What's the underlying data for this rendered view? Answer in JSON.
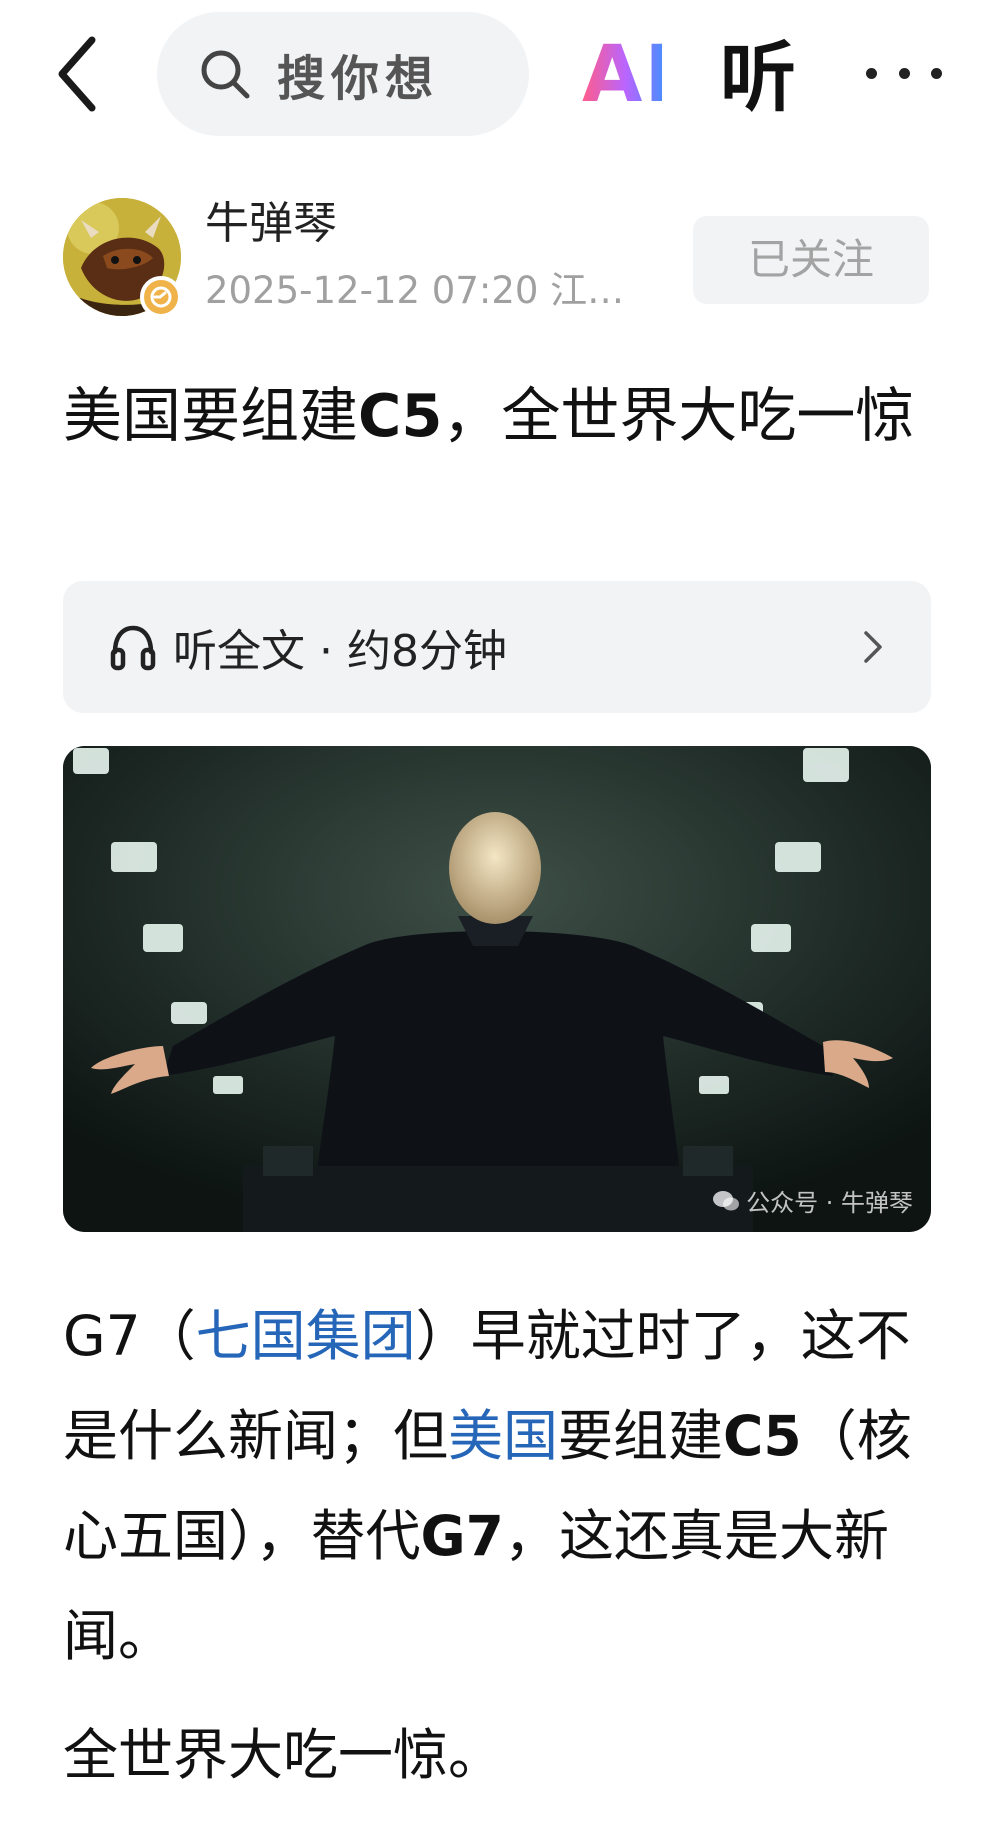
{
  "header": {
    "back_icon": "back-arrow-icon",
    "search_icon": "search-icon",
    "search_placeholder": "搜你想",
    "search_overflow": "搜",
    "ai_label": "AI",
    "listen_label": "听",
    "more_icon": "more-dots-icon"
  },
  "author": {
    "name": "牛弹琴",
    "meta": "2025-12-12  07:20  江…",
    "follow_label": "已关注",
    "badge_icon": "verified-badge-icon"
  },
  "article": {
    "title_a": "美国要组建",
    "title_b": "C5",
    "title_c": "，全世界大吃一惊",
    "listen_bar": {
      "icon": "headphone-icon",
      "label": "听全文 · 约8分钟",
      "chevron": "chevron-right-icon"
    },
    "image": {
      "watermark": "公众号 · 牛弹琴"
    },
    "p1": {
      "s1": "G7（",
      "link1": "七国集团",
      "s2": "）早就过时了，这不是什么新闻；但",
      "link2": "美国",
      "s3": "要组建",
      "b1": "C5",
      "s4": "（核心五国），替代",
      "b2": "G7",
      "s5": "，这还真是大新闻。"
    },
    "p2": "全世界大吃一惊。"
  },
  "colors": {
    "link": "#2566b8",
    "follow_bg": "#f2f3f5",
    "meta_gray": "#a0a0a0"
  }
}
